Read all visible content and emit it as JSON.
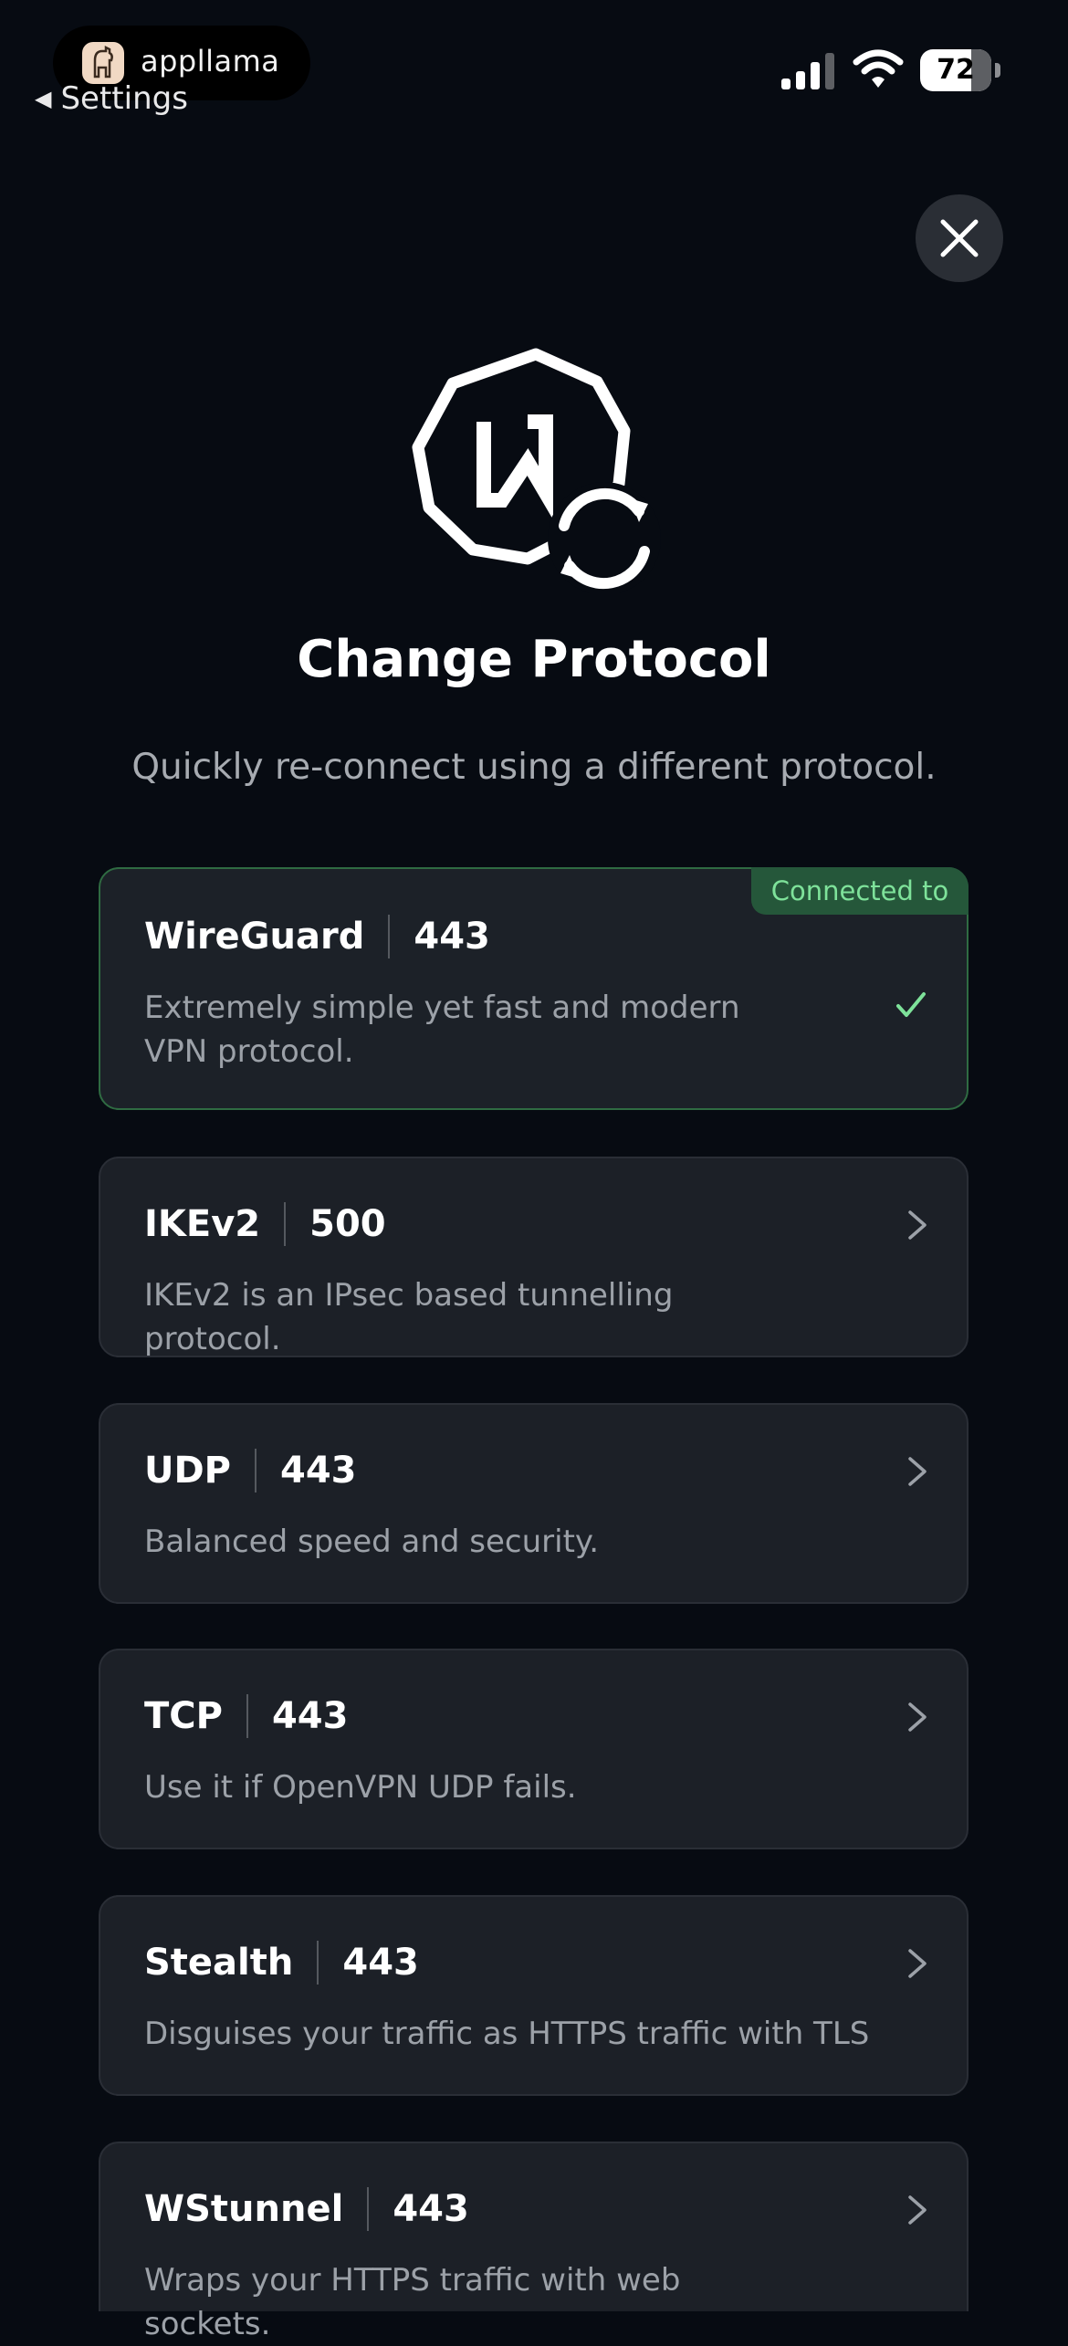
{
  "status_bar": {
    "brand": "appllama",
    "back_label": "Settings",
    "battery_level": "72",
    "battery_fraction": 0.72
  },
  "header": {
    "title": "Change Protocol",
    "subtitle": "Quickly re-connect using a different protocol."
  },
  "protocols": [
    {
      "name": "WireGuard",
      "port": "443",
      "description": "Extremely simple yet fast and modern VPN protocol.",
      "badge": "Connected to",
      "connected": true
    },
    {
      "name": "IKEv2",
      "port": "500",
      "description": "IKEv2 is an IPsec based tunnelling protocol.",
      "connected": false
    },
    {
      "name": "UDP",
      "port": "443",
      "description": "Balanced speed and security.",
      "connected": false
    },
    {
      "name": "TCP",
      "port": "443",
      "description": "Use it if OpenVPN UDP fails.",
      "connected": false
    },
    {
      "name": "Stealth",
      "port": "443",
      "description": "Disguises your traffic as HTTPS traffic with TLS",
      "connected": false
    },
    {
      "name": "WStunnel",
      "port": "443",
      "description": "Wraps your HTTPS traffic with web sockets.",
      "connected": false
    }
  ],
  "colors": {
    "background": "#070b12",
    "card": "#1c2027",
    "connected_accent": "#7ee29a",
    "connected_border": "#2f6b42"
  },
  "icons": {
    "close": "close-icon",
    "chevron": "chevron-right-icon",
    "check": "checkmark-icon",
    "hero": "protocol-change-icon"
  }
}
